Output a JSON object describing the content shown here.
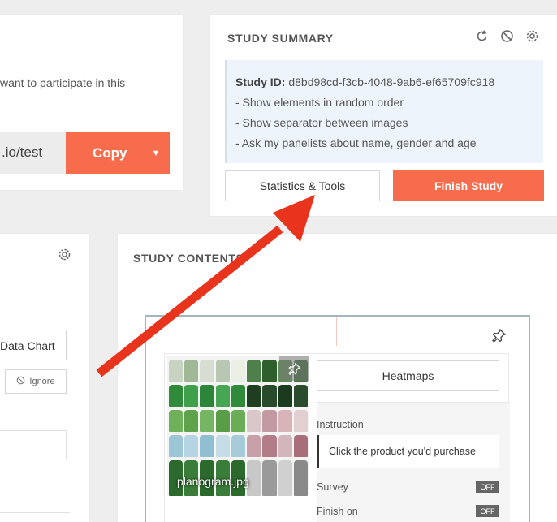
{
  "share": {
    "description": "want to participate in this",
    "url": ".io/test",
    "copy_label": "Copy",
    "caret": "▼"
  },
  "summary": {
    "title": "STUDY SUMMARY",
    "icons": [
      "refresh-icon",
      "block-icon",
      "gear-icon"
    ],
    "id_label": "Study ID:",
    "id_value": " d8bd98cd-f3cb-4048-9ab6-ef65709fc918",
    "options": [
      "- Show elements in random order",
      "- Show separator between images",
      "- Ask my panelists about name, gender and age"
    ],
    "stats_label": "Statistics & Tools",
    "finish_label": "Finish Study"
  },
  "tools": {
    "chart_label": "Data Chart",
    "ignore_label": "Ignore"
  },
  "contents": {
    "title": "STUDY CONTENTS",
    "file_name": "planogram.jpg",
    "heatmaps_label": "Heatmaps",
    "instruction_label": "Instruction",
    "instruction_text": "Click the product you'd purchase",
    "survey_label": "Survey",
    "survey_state": "OFF",
    "finish_on_label": "Finish on",
    "finish_on_state": "OFF"
  },
  "colors": {
    "accent": "#f66c4c",
    "arrow": "#e8341c",
    "info_bg": "#eef4fb",
    "frame": "#a5b5bd"
  }
}
